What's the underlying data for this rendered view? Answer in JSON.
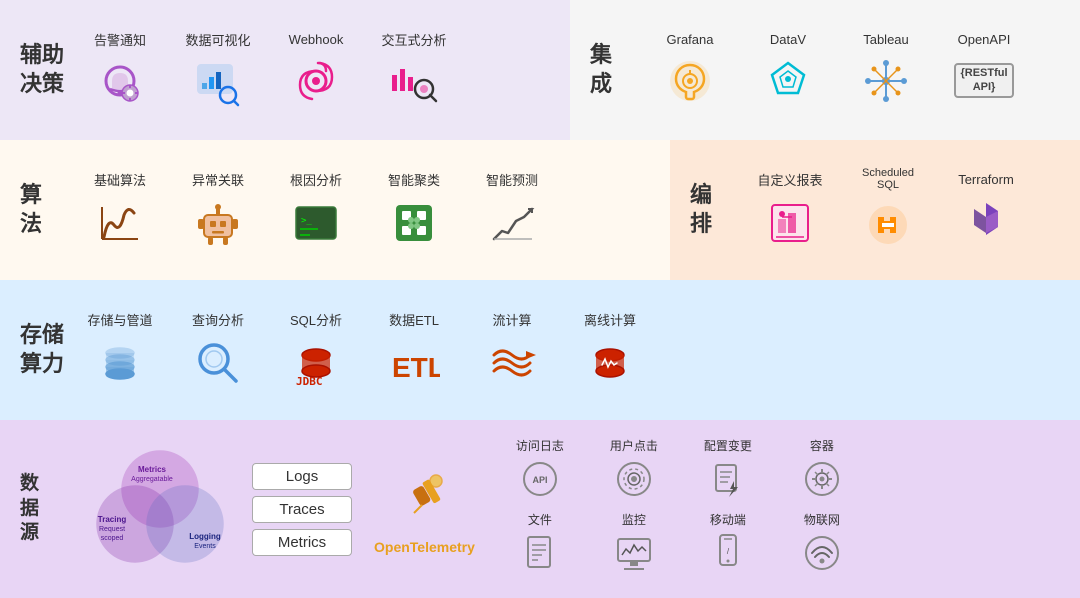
{
  "rows": {
    "row1_left": {
      "title": "辅助\n决策",
      "items": [
        {
          "label": "告警通知",
          "icon_type": "bell-gear"
        },
        {
          "label": "数据可视化",
          "icon_type": "chart-search"
        },
        {
          "label": "Webhook",
          "icon_type": "webhook"
        },
        {
          "label": "交互式分析",
          "icon_type": "analytics-search"
        }
      ]
    },
    "row1_right": {
      "title": "集\n成",
      "items": [
        {
          "label": "Grafana",
          "icon_type": "grafana"
        },
        {
          "label": "DataV",
          "icon_type": "datav"
        },
        {
          "label": "Tableau",
          "icon_type": "tableau"
        },
        {
          "label": "OpenAPI",
          "icon_type": "openapi"
        }
      ]
    },
    "row2_left": {
      "title": "算\n法",
      "items": [
        {
          "label": "基础算法",
          "icon_type": "algo-base"
        },
        {
          "label": "异常关联",
          "icon_type": "robot"
        },
        {
          "label": "根因分析",
          "icon_type": "terminal"
        },
        {
          "label": "智能聚类",
          "icon_type": "cluster"
        },
        {
          "label": "智能预测",
          "icon_type": "trend"
        }
      ]
    },
    "row2_right": {
      "title": "编\n排",
      "items": [
        {
          "label": "自定义报表",
          "icon_type": "custom-report"
        },
        {
          "label": "Scheduled SQL",
          "icon_type": "scheduled-sql"
        },
        {
          "label": "Terraform",
          "icon_type": "terraform"
        }
      ]
    },
    "row3": {
      "title": "存储\n算力",
      "items": [
        {
          "label": "存储与管道",
          "icon_type": "storage"
        },
        {
          "label": "查询分析",
          "icon_type": "search-analysis"
        },
        {
          "label": "SQL分析",
          "icon_type": "jdbc"
        },
        {
          "label": "数据ETL",
          "icon_type": "etl"
        },
        {
          "label": "流计算",
          "icon_type": "stream"
        },
        {
          "label": "离线计算",
          "icon_type": "offline"
        }
      ]
    },
    "row4": {
      "title": "数\n据\n源",
      "venn": {
        "circles": [
          {
            "label": "Metrics\nAggregatable",
            "x": 55,
            "y": 10,
            "color": "#9c27b0"
          },
          {
            "label": "Tracing\nRequest\nscoped",
            "x": 25,
            "y": 50,
            "color": "#7b1fa2"
          },
          {
            "label": "Logging\nEvents",
            "x": 85,
            "y": 50,
            "color": "#5c6bc0"
          }
        ]
      },
      "obs_boxes": [
        "Logs",
        "Traces",
        "Metrics"
      ],
      "otel_label": "OpenTelemetry",
      "datasources": [
        {
          "label": "访问日志",
          "icon_type": "api-log",
          "row": 0,
          "col": 0
        },
        {
          "label": "用户点击",
          "icon_type": "user-click",
          "row": 0,
          "col": 1
        },
        {
          "label": "配置变更",
          "icon_type": "config-change",
          "row": 0,
          "col": 2
        },
        {
          "label": "容器",
          "icon_type": "container",
          "row": 0,
          "col": 3
        },
        {
          "label": "文件",
          "icon_type": "file",
          "row": 1,
          "col": 0
        },
        {
          "label": "监控",
          "icon_type": "monitor",
          "row": 1,
          "col": 1
        },
        {
          "label": "移动端",
          "icon_type": "mobile",
          "row": 1,
          "col": 2
        },
        {
          "label": "物联网",
          "icon_type": "iot",
          "row": 1,
          "col": 3
        }
      ]
    }
  }
}
